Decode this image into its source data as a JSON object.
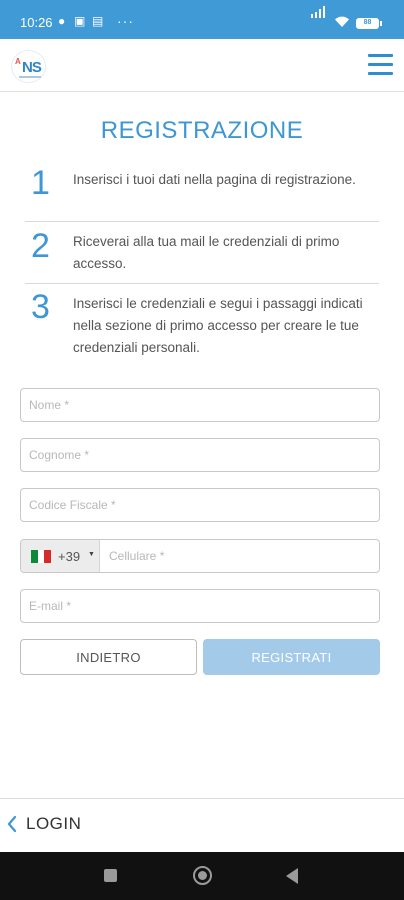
{
  "status_bar": {
    "time": "10:26",
    "more": "···",
    "battery": "88"
  },
  "header": {
    "logo_text": "NS",
    "logo_mark": "A"
  },
  "page": {
    "title": "REGISTRAZIONE"
  },
  "steps": [
    {
      "number": "1",
      "text": "Inserisci i tuoi dati nella pagina di registrazione."
    },
    {
      "number": "2",
      "text": "Riceverai alla tua mail le credenziali di primo accesso."
    },
    {
      "number": "3",
      "text": "Inserisci le credenziali e segui i passaggi indicati nella sezione di primo accesso per creare le tue credenziali personali."
    }
  ],
  "form": {
    "nome_placeholder": "Nome *",
    "cognome_placeholder": "Cognome *",
    "codice_fiscale_placeholder": "Codice Fiscale *",
    "country_code": "+39",
    "cellulare_placeholder": "Cellulare *",
    "email_placeholder": "E-mail *"
  },
  "buttons": {
    "back_label": "INDIETRO",
    "register_label": "REGISTRATI"
  },
  "footer": {
    "login_label": "LOGIN"
  },
  "colors": {
    "accent": "#3d97d4",
    "status_bar": "#3f9ad6",
    "button_disabled": "#a3cbe9"
  }
}
